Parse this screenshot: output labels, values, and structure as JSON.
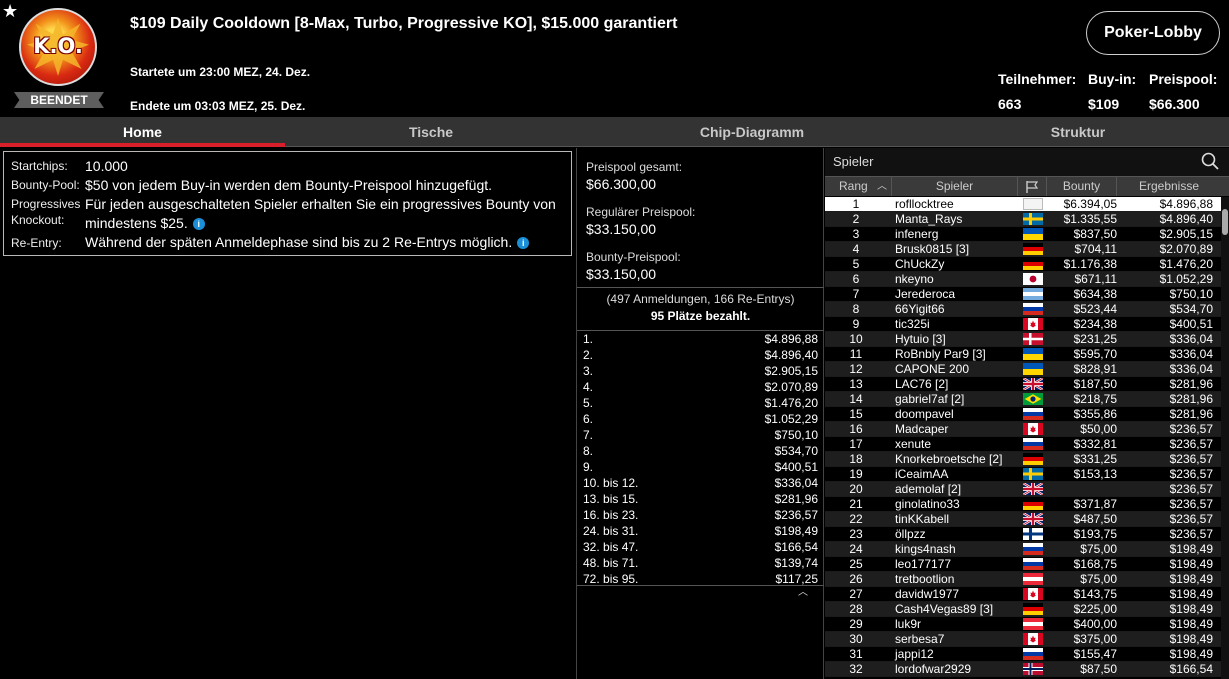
{
  "header": {
    "logo_text": "K.O.",
    "badge": "BEENDET",
    "title": "$109 Daily Cooldown [8-Max, Turbo, Progressive KO], $15.000 garantiert",
    "started": "Startete um 23:00 MEZ, 24. Dez.",
    "ended": "Endete um 03:03 MEZ, 25. Dez.",
    "lobby_button": "Poker-Lobby",
    "stats": [
      {
        "label": "Teilnehmer:",
        "value": "663"
      },
      {
        "label": "Buy-in:",
        "value": "$109"
      },
      {
        "label": "Preispool:",
        "value": "$66.300"
      }
    ]
  },
  "tabs": [
    "Home",
    "Tische",
    "Chip-Diagramm",
    "Struktur"
  ],
  "info": [
    {
      "label": "Startchips:",
      "value": "10.000"
    },
    {
      "label": "Bounty-Pool:",
      "value": "$50 von jedem Buy-in werden dem Bounty-Preispool hinzugefügt."
    },
    {
      "label": "Progressives",
      "label2": "Knockout:",
      "value": "Für jeden ausgeschalteten Spieler erhalten Sie ein progressives Bounty von",
      "value2": "mindestens $25."
    },
    {
      "label": "Re-Entry:",
      "value": "Während der späten Anmeldephase sind bis zu 2 Re-Entrys möglich."
    }
  ],
  "prizepool": {
    "total_label": "Preispool gesamt:",
    "total_value": "$66.300,00",
    "regular_label": "Regulärer Preispool:",
    "regular_value": "$33.150,00",
    "bounty_label": "Bounty-Preispool:",
    "bounty_value": "$33.150,00",
    "entries": "(497 Anmeldungen, 166 Re-Entrys)",
    "paid": "95 Plätze bezahlt.",
    "payouts": [
      {
        "place": "1.",
        "amount": "$4.896,88"
      },
      {
        "place": "2.",
        "amount": "$4.896,40"
      },
      {
        "place": "3.",
        "amount": "$2.905,15"
      },
      {
        "place": "4.",
        "amount": "$2.070,89"
      },
      {
        "place": "5.",
        "amount": "$1.476,20"
      },
      {
        "place": "6.",
        "amount": "$1.052,29"
      },
      {
        "place": "7.",
        "amount": "$750,10"
      },
      {
        "place": "8.",
        "amount": "$534,70"
      },
      {
        "place": "9.",
        "amount": "$400,51"
      },
      {
        "place": "10. bis 12.",
        "amount": "$336,04"
      },
      {
        "place": "13. bis 15.",
        "amount": "$281,96"
      },
      {
        "place": "16. bis 23.",
        "amount": "$236,57"
      },
      {
        "place": "24. bis 31.",
        "amount": "$198,49"
      },
      {
        "place": "32. bis 47.",
        "amount": "$166,54"
      },
      {
        "place": "48. bis 71.",
        "amount": "$139,74"
      },
      {
        "place": "72. bis 95.",
        "amount": "$117,25"
      }
    ]
  },
  "players": {
    "search_placeholder": "Spieler",
    "columns": {
      "rank": "Rang",
      "player": "Spieler",
      "bounty": "Bounty",
      "results": "Ergebnisse"
    },
    "rows": [
      {
        "rank": "1",
        "name": "rofllocktree",
        "flag": "white",
        "bounty": "$6.394,05",
        "result": "$4.896,88"
      },
      {
        "rank": "2",
        "name": "Manta_Rays",
        "flag": "se",
        "bounty": "$1.335,55",
        "result": "$4.896,40"
      },
      {
        "rank": "3",
        "name": "infenerg",
        "flag": "ua",
        "bounty": "$837,50",
        "result": "$2.905,15"
      },
      {
        "rank": "4",
        "name": "Brusk0815 [3]",
        "flag": "de",
        "bounty": "$704,11",
        "result": "$2.070,89"
      },
      {
        "rank": "5",
        "name": "ChUckZy",
        "flag": "de",
        "bounty": "$1.176,38",
        "result": "$1.476,20"
      },
      {
        "rank": "6",
        "name": "nkeyno",
        "flag": "jp",
        "bounty": "$671,11",
        "result": "$1.052,29"
      },
      {
        "rank": "7",
        "name": "Jerederoca",
        "flag": "ar",
        "bounty": "$634,38",
        "result": "$750,10"
      },
      {
        "rank": "8",
        "name": "66Yigit66",
        "flag": "ru",
        "bounty": "$523,44",
        "result": "$534,70"
      },
      {
        "rank": "9",
        "name": "tic325i",
        "flag": "ca",
        "bounty": "$234,38",
        "result": "$400,51"
      },
      {
        "rank": "10",
        "name": "Hytuio [3]",
        "flag": "dk",
        "bounty": "$231,25",
        "result": "$336,04"
      },
      {
        "rank": "11",
        "name": "RoBnbly Par9 [3]",
        "flag": "ua",
        "bounty": "$595,70",
        "result": "$336,04"
      },
      {
        "rank": "12",
        "name": "CAPONE 200",
        "flag": "ua",
        "bounty": "$828,91",
        "result": "$336,04"
      },
      {
        "rank": "13",
        "name": "LAC76 [2]",
        "flag": "gb",
        "bounty": "$187,50",
        "result": "$281,96"
      },
      {
        "rank": "14",
        "name": "gabriel7af [2]",
        "flag": "br",
        "bounty": "$218,75",
        "result": "$281,96"
      },
      {
        "rank": "15",
        "name": "doompavel",
        "flag": "ru",
        "bounty": "$355,86",
        "result": "$281,96"
      },
      {
        "rank": "16",
        "name": "Madcaper",
        "flag": "ca",
        "bounty": "$50,00",
        "result": "$236,57"
      },
      {
        "rank": "17",
        "name": "xenute",
        "flag": "ru",
        "bounty": "$332,81",
        "result": "$236,57"
      },
      {
        "rank": "18",
        "name": "Knorkebroetsche [2]",
        "flag": "de",
        "bounty": "$331,25",
        "result": "$236,57"
      },
      {
        "rank": "19",
        "name": "iCeaimAA",
        "flag": "se",
        "bounty": "$153,13",
        "result": "$236,57"
      },
      {
        "rank": "20",
        "name": "ademolaf [2]",
        "flag": "gb",
        "bounty": "",
        "result": "$236,57"
      },
      {
        "rank": "21",
        "name": "ginolatino33",
        "flag": "de",
        "bounty": "$371,87",
        "result": "$236,57"
      },
      {
        "rank": "22",
        "name": "tinKKabell",
        "flag": "gb",
        "bounty": "$487,50",
        "result": "$236,57"
      },
      {
        "rank": "23",
        "name": "öllpzz",
        "flag": "fi",
        "bounty": "$193,75",
        "result": "$236,57"
      },
      {
        "rank": "24",
        "name": "kings4nash",
        "flag": "ru",
        "bounty": "$75,00",
        "result": "$198,49"
      },
      {
        "rank": "25",
        "name": "leo177177",
        "flag": "ru",
        "bounty": "$168,75",
        "result": "$198,49"
      },
      {
        "rank": "26",
        "name": "tretbootlion",
        "flag": "at",
        "bounty": "$75,00",
        "result": "$198,49"
      },
      {
        "rank": "27",
        "name": "davidw1977",
        "flag": "ca",
        "bounty": "$143,75",
        "result": "$198,49"
      },
      {
        "rank": "28",
        "name": "Cash4Vegas89 [3]",
        "flag": "de",
        "bounty": "$225,00",
        "result": "$198,49"
      },
      {
        "rank": "29",
        "name": "luk9r",
        "flag": "at",
        "bounty": "$400,00",
        "result": "$198,49"
      },
      {
        "rank": "30",
        "name": "serbesa7",
        "flag": "ca",
        "bounty": "$375,00",
        "result": "$198,49"
      },
      {
        "rank": "31",
        "name": "jappi12",
        "flag": "ru",
        "bounty": "$155,47",
        "result": "$198,49"
      },
      {
        "rank": "32",
        "name": "lordofwar2929",
        "flag": "no",
        "bounty": "$87,50",
        "result": "$166,54"
      }
    ]
  }
}
